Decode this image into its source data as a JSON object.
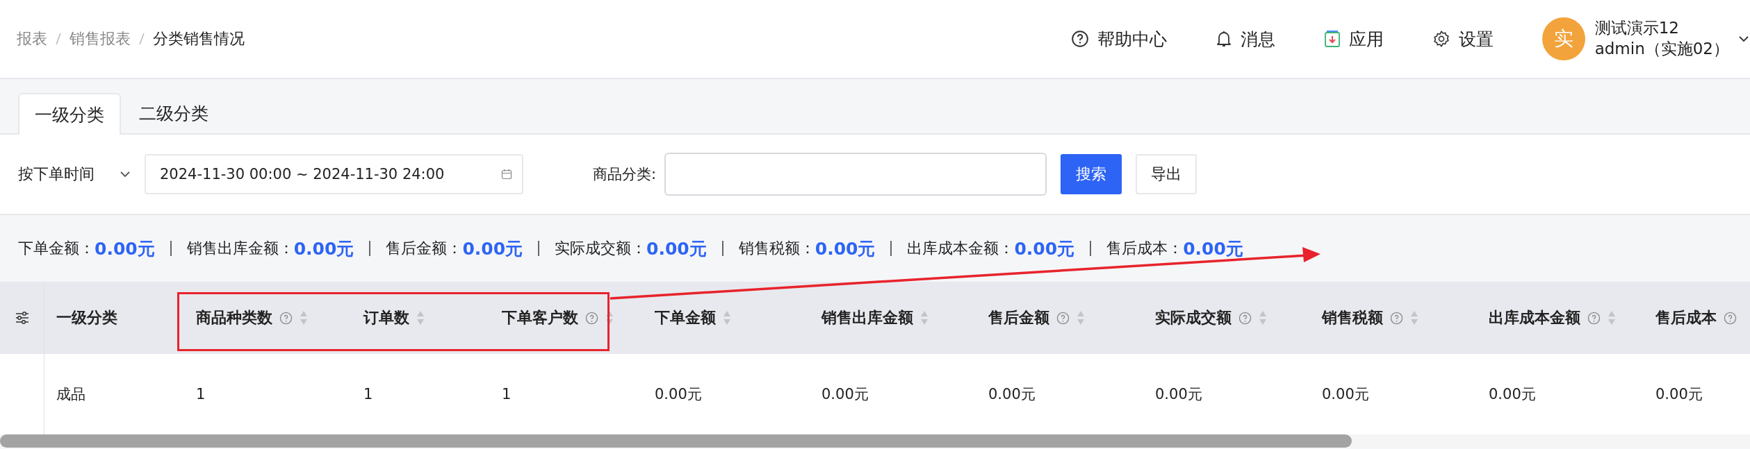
{
  "breadcrumb": [
    {
      "label": "报表",
      "current": false
    },
    {
      "label": "销售报表",
      "current": false
    },
    {
      "label": "分类销售情况",
      "current": true
    }
  ],
  "header_actions": [
    {
      "kind": "help",
      "label": "帮助中心"
    },
    {
      "kind": "bell",
      "label": "消息"
    },
    {
      "kind": "app",
      "label": "应用"
    },
    {
      "kind": "gear",
      "label": "设置"
    }
  ],
  "user": {
    "avatar": "实",
    "name": "测试演示12",
    "account": "admin（实施02）"
  },
  "tabs": [
    {
      "label": "一级分类",
      "selected": true
    },
    {
      "label": "二级分类",
      "selected": false
    }
  ],
  "filters": {
    "time_mode": "按下单时间",
    "date_range": "2024-11-30 00:00 ~ 2024-11-30 24:00",
    "category_label": "商品分类:",
    "search_button": "搜索",
    "export_button": "导出"
  },
  "summary": [
    {
      "label": "下单金额：",
      "value": "0.00元"
    },
    {
      "label": "销售出库金额：",
      "value": "0.00元"
    },
    {
      "label": "售后金额：",
      "value": "0.00元"
    },
    {
      "label": "实际成交额：",
      "value": "0.00元"
    },
    {
      "label": "销售税额：",
      "value": "0.00元"
    },
    {
      "label": "出库成本金额：",
      "value": "0.00元"
    },
    {
      "label": "售后成本：",
      "value": "0.00元"
    }
  ],
  "table": {
    "columns": [
      {
        "label": "一级分类",
        "help": false,
        "sortable": false
      },
      {
        "label": "商品种类数",
        "help": true,
        "sortable": true
      },
      {
        "label": "订单数",
        "help": false,
        "sortable": true
      },
      {
        "label": "下单客户数",
        "help": true,
        "sortable": true
      },
      {
        "label": "下单金额",
        "help": false,
        "sortable": true
      },
      {
        "label": "销售出库金额",
        "help": false,
        "sortable": true
      },
      {
        "label": "售后金额",
        "help": true,
        "sortable": true
      },
      {
        "label": "实际成交额",
        "help": true,
        "sortable": true
      },
      {
        "label": "销售税额",
        "help": true,
        "sortable": true
      },
      {
        "label": "出库成本金额",
        "help": true,
        "sortable": true
      },
      {
        "label": "售后成本",
        "help": true,
        "sortable": false
      }
    ],
    "rows": [
      [
        "成品",
        "1",
        "1",
        "1",
        "0.00元",
        "0.00元",
        "0.00元",
        "0.00元",
        "0.00元",
        "0.00元",
        "0.00元"
      ]
    ]
  }
}
